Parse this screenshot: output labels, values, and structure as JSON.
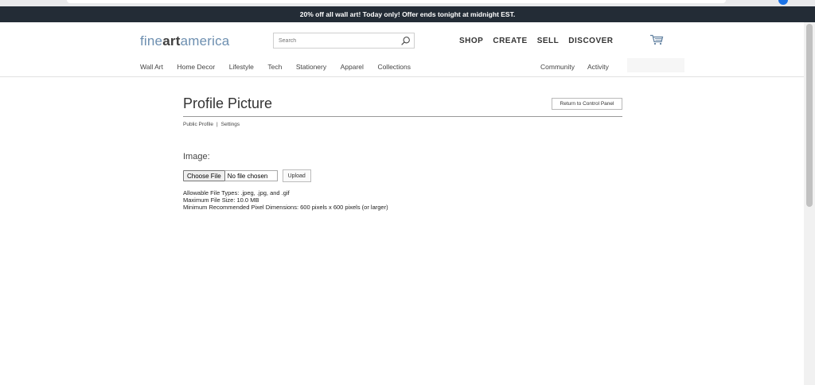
{
  "promo": {
    "text": "20% off all wall art!  Today only!  Offer ends tonight at midnight EST."
  },
  "header": {
    "logo_part1": "fine",
    "logo_part2": "art",
    "logo_part3": "america",
    "search_placeholder": "Search",
    "search_value": "",
    "main_nav": [
      "SHOP",
      "CREATE",
      "SELL",
      "DISCOVER"
    ],
    "sub_nav": [
      "Wall Art",
      "Home Decor",
      "Lifestyle",
      "Tech",
      "Stationery",
      "Apparel",
      "Collections"
    ],
    "sub_nav_right": [
      "Community",
      "Activity"
    ]
  },
  "page": {
    "title": "Profile Picture",
    "return_button": "Return to Control Panel",
    "breadcrumb": [
      "Public Profile",
      "Settings"
    ],
    "breadcrumb_separator": "|",
    "image_label": "Image:",
    "choose_file_label": "Choose File",
    "file_status": "No file chosen",
    "upload_label": "Upload",
    "info_lines": [
      "Allowable File Types: .jpeg, .jpg, and .gif",
      "Maximum File Size: 10.0 MB",
      "Minimum Recommended Pixel Dimensions: 600 pixels x 600 pixels (or larger)"
    ]
  },
  "icons": {
    "search": "search-icon",
    "cart": "cart-icon"
  },
  "colors": {
    "promo_bg": "#232c36",
    "logo_accent": "#6d8fb0"
  }
}
